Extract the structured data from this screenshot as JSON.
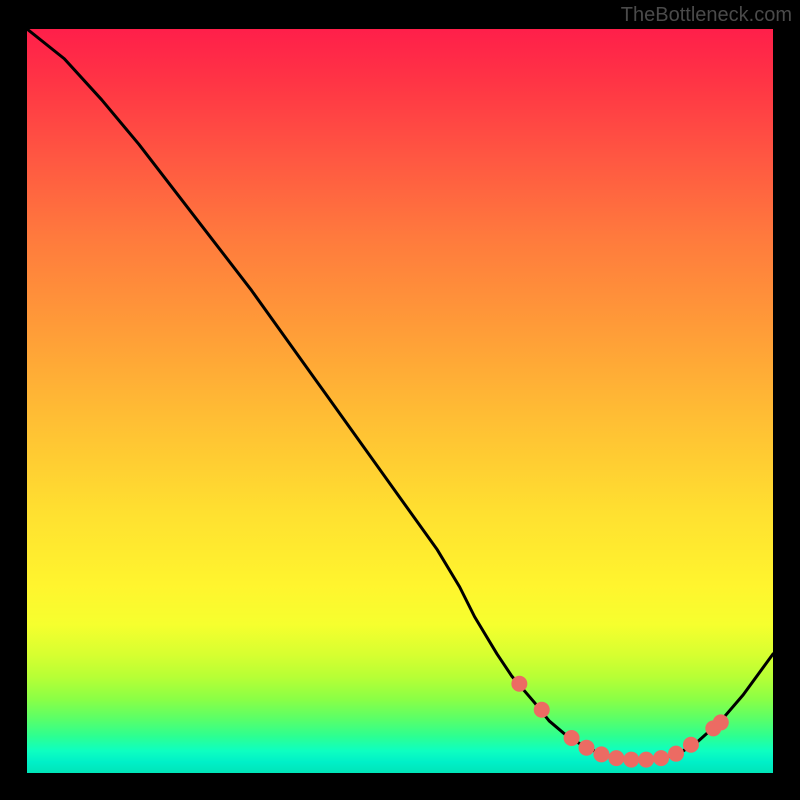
{
  "watermark": "TheBottleneck.com",
  "chart_data": {
    "type": "line",
    "title": "",
    "xlabel": "",
    "ylabel": "",
    "xlim": [
      0,
      100
    ],
    "ylim": [
      0,
      100
    ],
    "series": [
      {
        "name": "bottleneck-curve",
        "x": [
          0,
          5,
          10,
          15,
          20,
          25,
          30,
          35,
          40,
          45,
          50,
          55,
          58,
          60,
          63,
          65,
          68,
          70,
          72,
          74,
          76,
          78,
          80,
          82,
          84,
          86,
          88,
          90,
          93,
          96,
          100
        ],
        "y": [
          100,
          96,
          90.5,
          84.5,
          78,
          71.5,
          65,
          58,
          51,
          44,
          37,
          30,
          25,
          21,
          16,
          13,
          9.5,
          7,
          5.3,
          4.0,
          3.0,
          2.3,
          1.9,
          1.8,
          1.9,
          2.2,
          3.0,
          4.3,
          7.0,
          10.5,
          16
        ]
      }
    ],
    "markers": {
      "name": "highlight-markers",
      "color": "#ec6b63",
      "radius_px": 8,
      "points": [
        {
          "x": 66,
          "y": 12
        },
        {
          "x": 69,
          "y": 8.5
        },
        {
          "x": 73,
          "y": 4.7
        },
        {
          "x": 75,
          "y": 3.4
        },
        {
          "x": 77,
          "y": 2.5
        },
        {
          "x": 79,
          "y": 2.0
        },
        {
          "x": 81,
          "y": 1.8
        },
        {
          "x": 83,
          "y": 1.8
        },
        {
          "x": 85,
          "y": 2.0
        },
        {
          "x": 87,
          "y": 2.6
        },
        {
          "x": 89,
          "y": 3.8
        },
        {
          "x": 92,
          "y": 6.0
        },
        {
          "x": 93,
          "y": 6.8
        }
      ]
    },
    "gradient_stops": [
      {
        "pos": 0,
        "color": "#ff1f4a"
      },
      {
        "pos": 0.5,
        "color": "#ffd030"
      },
      {
        "pos": 0.8,
        "color": "#eaff2e"
      },
      {
        "pos": 1.0,
        "color": "#00e4b8"
      }
    ]
  }
}
